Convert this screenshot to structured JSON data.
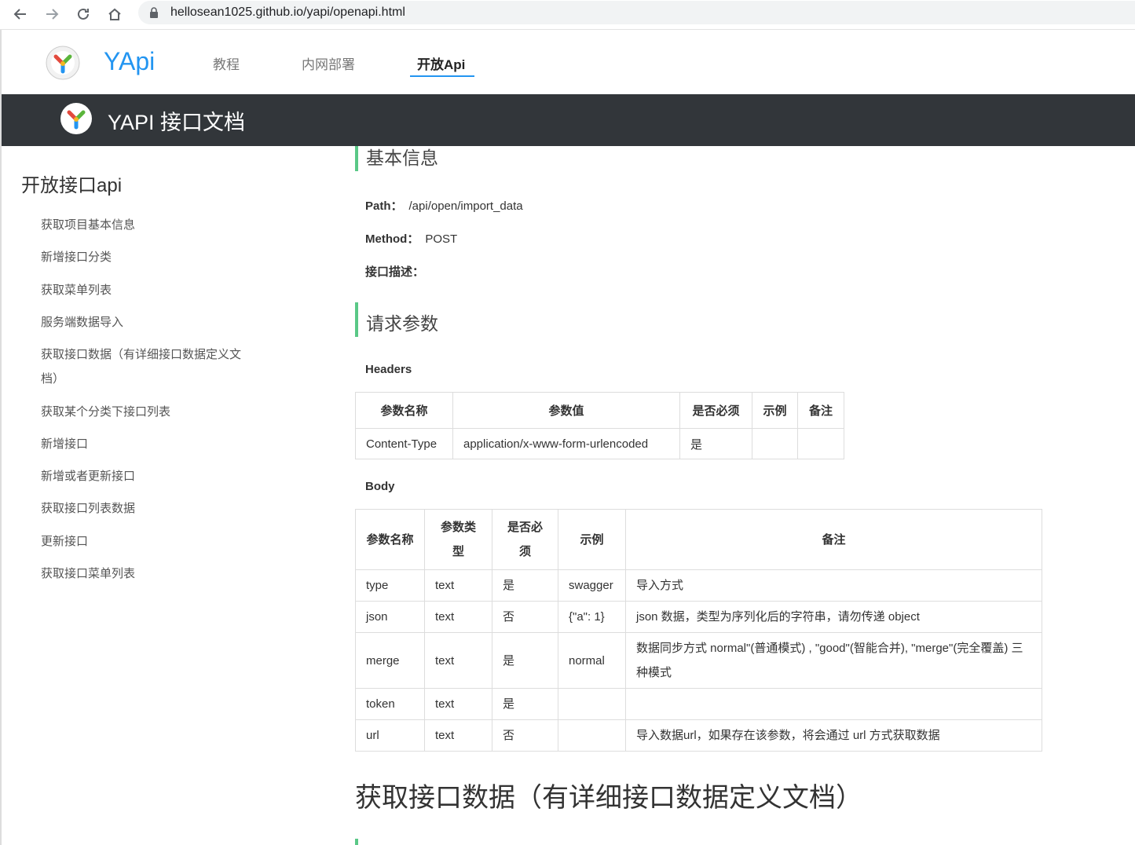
{
  "browser": {
    "url": "hellosean1025.github.io/yapi/openapi.html"
  },
  "header": {
    "site_title": "YApi",
    "nav": [
      {
        "label": "教程"
      },
      {
        "label": "内网部署"
      },
      {
        "label": "开放Api"
      }
    ]
  },
  "banner": {
    "title": "YAPI 接口文档"
  },
  "sidebar": {
    "title": "开放接口api",
    "items": [
      {
        "label": "获取项目基本信息"
      },
      {
        "label": "新增接口分类"
      },
      {
        "label": "获取菜单列表"
      },
      {
        "label": "服务端数据导入"
      },
      {
        "label": "获取接口数据（有详细接口数据定义文档）"
      },
      {
        "label": "获取某个分类下接口列表"
      },
      {
        "label": "新增接口"
      },
      {
        "label": "新增或者更新接口"
      },
      {
        "label": "获取接口列表数据"
      },
      {
        "label": "更新接口"
      },
      {
        "label": "获取接口菜单列表"
      }
    ]
  },
  "content": {
    "basic_info_title": "基本信息",
    "path_label": "Path：",
    "path_value": "/api/open/import_data",
    "method_label": "Method：",
    "method_value": "POST",
    "desc_label": "接口描述：",
    "request_title": "请求参数",
    "headers_title": "Headers",
    "headers_table": {
      "columns": [
        "参数名称",
        "参数值",
        "是否必须",
        "示例",
        "备注"
      ],
      "rows": [
        [
          "Content-Type",
          "application/x-www-form-urlencoded",
          "是",
          "",
          ""
        ]
      ]
    },
    "body_title": "Body",
    "body_table": {
      "columns": [
        "参数名称",
        "参数类型",
        "是否必须",
        "示例",
        "备注"
      ],
      "rows": [
        [
          "type",
          "text",
          "是",
          "swagger",
          "导入方式"
        ],
        [
          "json",
          "text",
          "否",
          "{\"a\": 1}",
          "json 数据，类型为序列化后的字符串，请勿传递 object"
        ],
        [
          "merge",
          "text",
          "是",
          "normal",
          "数据同步方式 normal\"(普通模式) , \"good\"(智能合并), \"merge\"(完全覆盖) 三种模式"
        ],
        [
          "token",
          "text",
          "是",
          "",
          ""
        ],
        [
          "url",
          "text",
          "否",
          "",
          "导入数据url，如果存在该参数，将会通过 url 方式获取数据"
        ]
      ]
    },
    "next_heading": "获取接口数据（有详细接口数据定义文档）"
  }
}
